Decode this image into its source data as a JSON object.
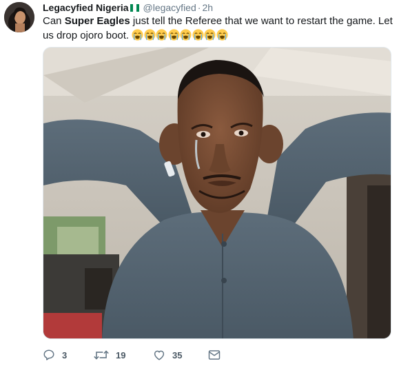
{
  "tweet": {
    "display_name": "Legacyfied Nigeria",
    "handle": "@legacyfied",
    "separator": "·",
    "time": "2h",
    "text_before": "Can ",
    "text_bold": "Super Eagles",
    "text_after": " just tell the Referee that we want to restart the game. Let us drop ojoro boot. ",
    "emoji_name": "loudly-crying-face",
    "emoji_count": 8,
    "flag_colors": [
      "#008751",
      "#ffffff",
      "#008751"
    ],
    "accent_color": "#1da1f2"
  },
  "actions": {
    "reply_count": "3",
    "retweet_count": "19",
    "like_count": "35"
  }
}
